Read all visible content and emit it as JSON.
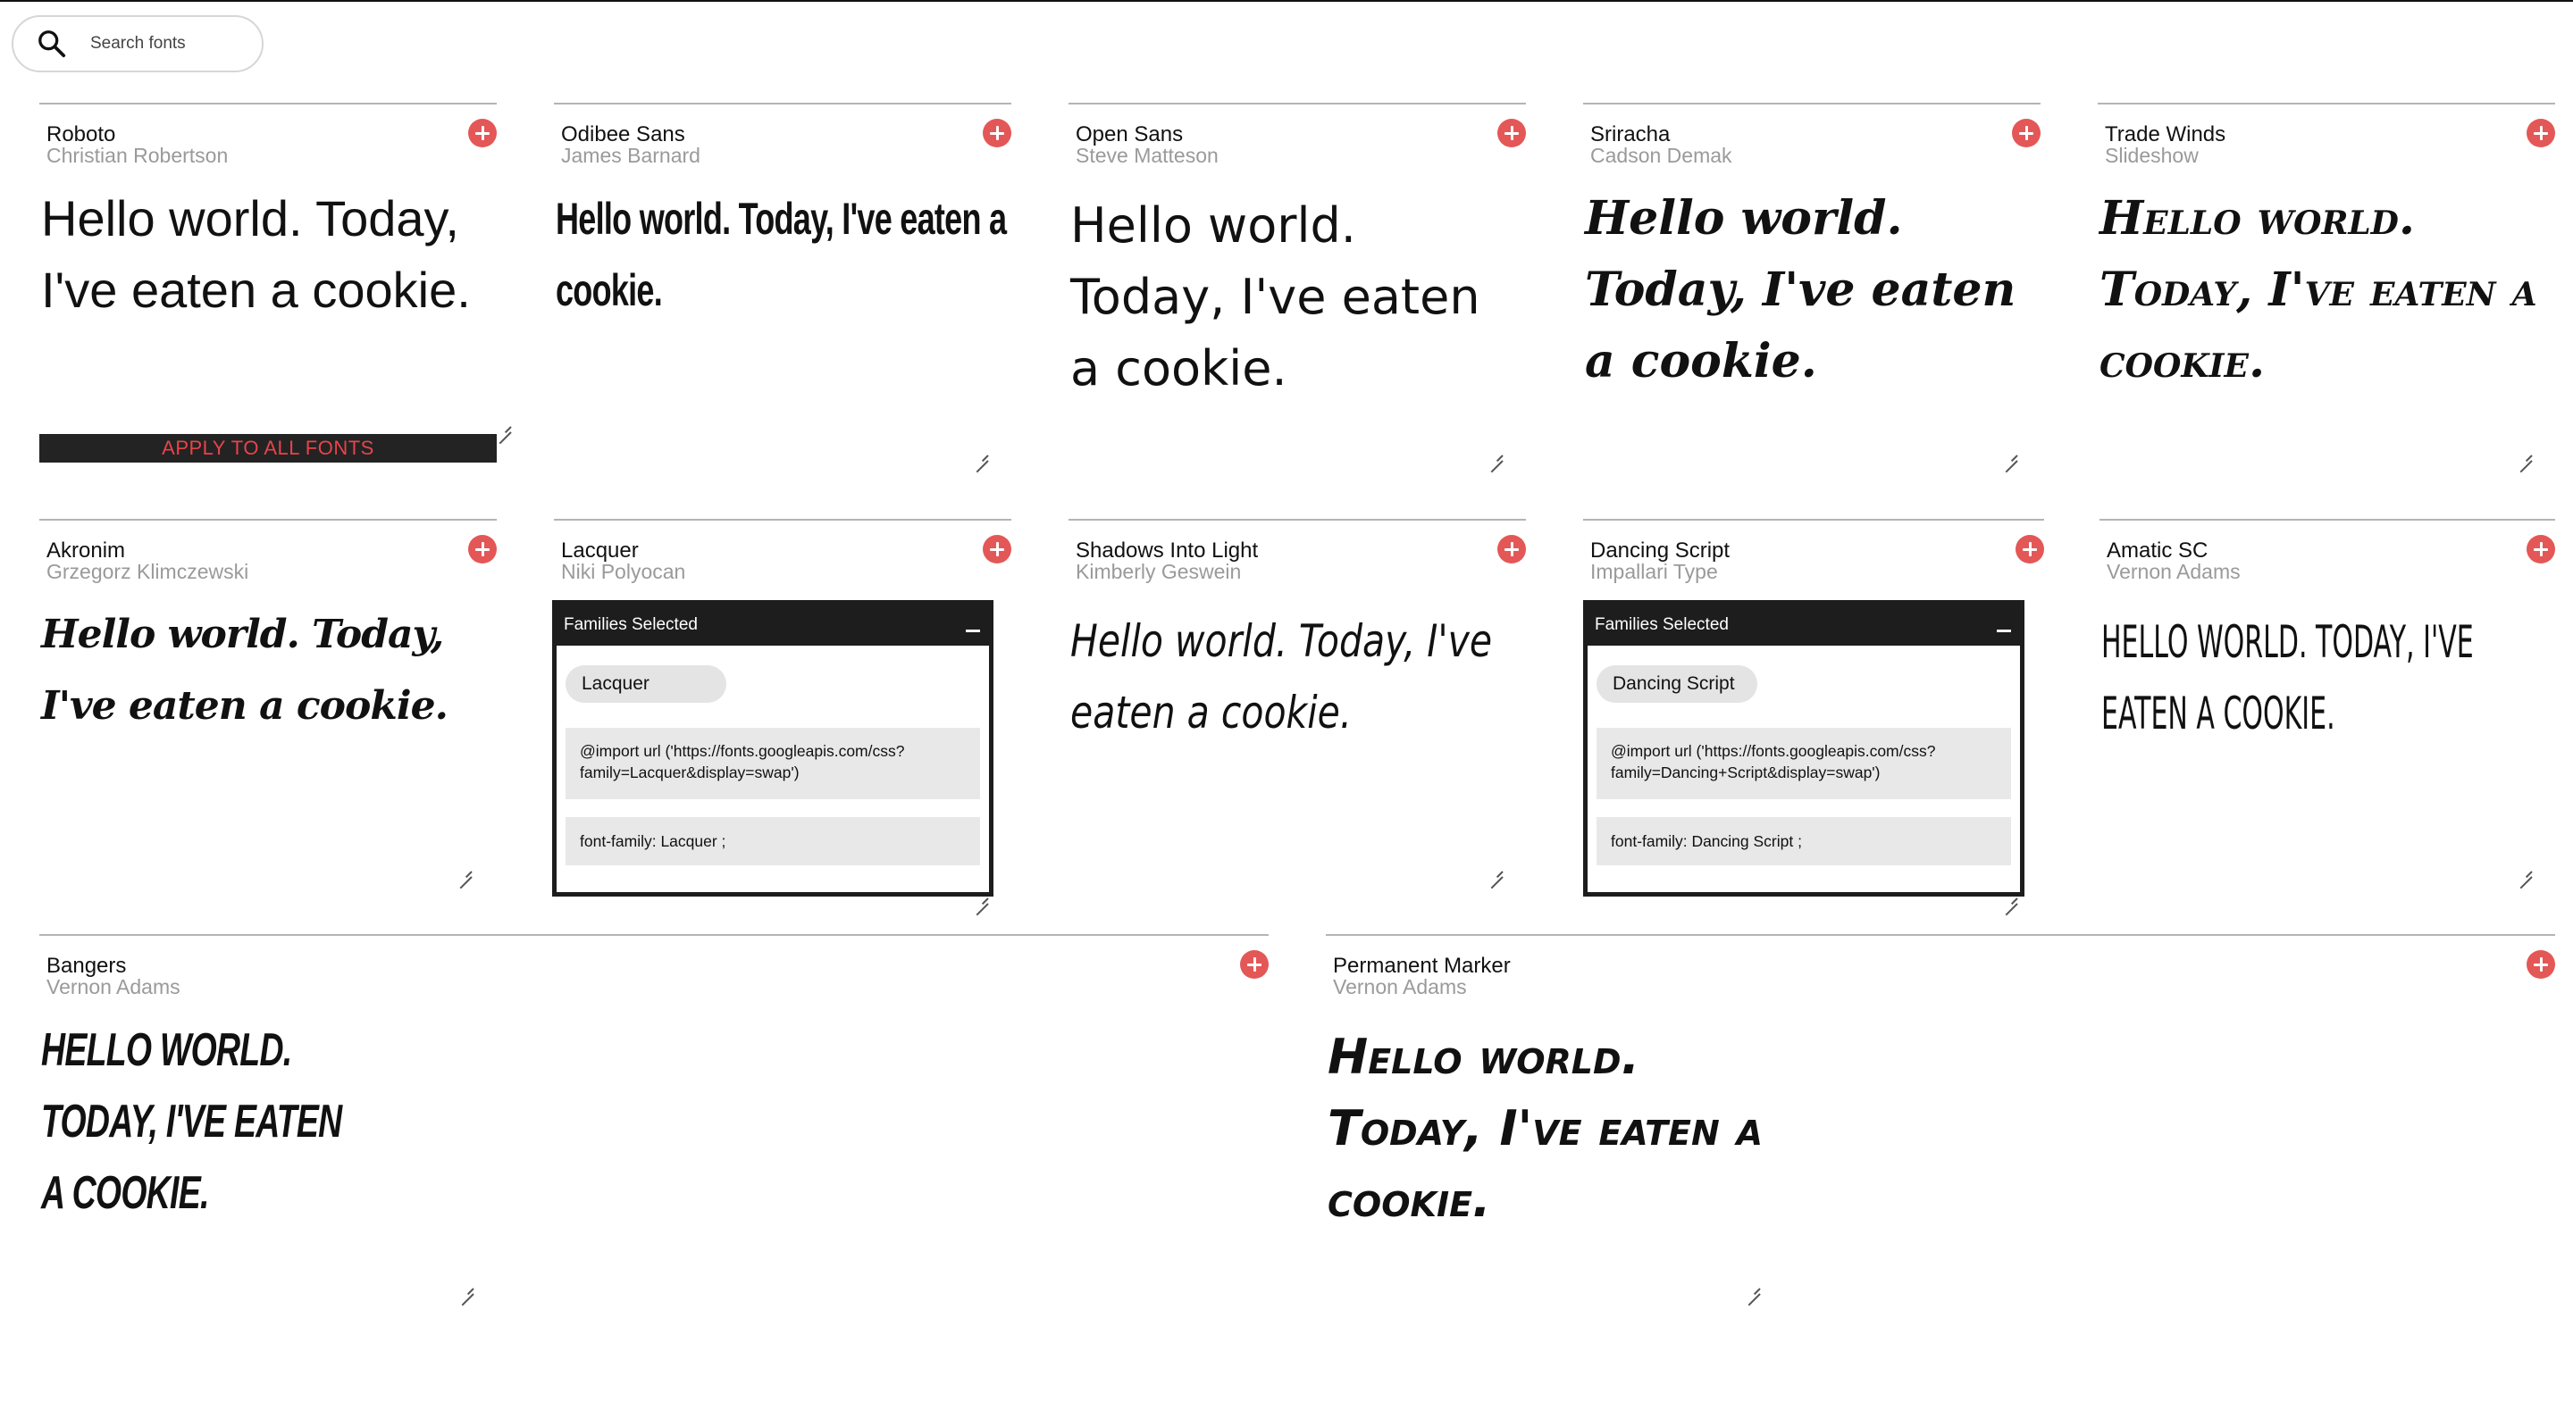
{
  "search": {
    "placeholder": "Search fonts"
  },
  "sample_text": "Hello world. Today, I've eaten a cookie.",
  "apply_all_label": "APPLY TO ALL FONTS",
  "colors": {
    "accent": "#e45757",
    "apply_text": "#e8434a",
    "dark": "#1d1d1d"
  },
  "fonts": [
    {
      "name": "Roboto",
      "designer": "Christian Robertson"
    },
    {
      "name": "Odibee Sans",
      "designer": "James Barnard"
    },
    {
      "name": "Open Sans",
      "designer": "Steve Matteson"
    },
    {
      "name": "Sriracha",
      "designer": "Cadson Demak"
    },
    {
      "name": "Trade Winds",
      "designer": "Slideshow"
    },
    {
      "name": "Akronim",
      "designer": "Grzegorz Klimczewski"
    },
    {
      "name": "Lacquer",
      "designer": "Niki Polyocan"
    },
    {
      "name": "Shadows Into Light",
      "designer": "Kimberly Geswein"
    },
    {
      "name": "Dancing Script",
      "designer": "Impallari Type"
    },
    {
      "name": "Amatic SC",
      "designer": "Vernon Adams"
    },
    {
      "name": "Bangers",
      "designer": "Vernon Adams"
    },
    {
      "name": "Permanent Marker",
      "designer": "Vernon Adams"
    }
  ],
  "popups": [
    {
      "title": "Families Selected",
      "chip": "Lacquer",
      "import": "@import url ('https://fonts.googleapis.com/css?family=Lacquer&display=swap')",
      "font_family": "font-family: Lacquer ;"
    },
    {
      "title": "Families Selected",
      "chip": "Dancing Script",
      "import": "@import url ('https://fonts.googleapis.com/css?family=Dancing+Script&display=swap')",
      "font_family": "font-family: Dancing Script ;"
    }
  ]
}
